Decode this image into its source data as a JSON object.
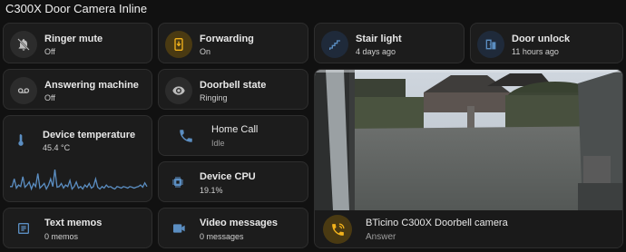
{
  "page": {
    "title": "C300X Door Camera Inline"
  },
  "tiles": {
    "ringer_mute": {
      "name": "Ringer mute",
      "state": "Off",
      "icon": "bell-off-icon"
    },
    "forwarding": {
      "name": "Forwarding",
      "state": "On",
      "icon": "forward-phone-icon"
    },
    "stair_light": {
      "name": "Stair light",
      "state": "4 days ago",
      "icon": "stairs-icon"
    },
    "door_unlock": {
      "name": "Door unlock",
      "state": "11 hours ago",
      "icon": "door-icon"
    },
    "answering_machine": {
      "name": "Answering machine",
      "state": "Off",
      "icon": "voicemail-icon"
    },
    "doorbell_state": {
      "name": "Doorbell state",
      "state": "Ringing",
      "icon": "eye-icon"
    },
    "device_temperature": {
      "name": "Device temperature",
      "state": "45.4 °C",
      "icon": "thermometer-icon"
    },
    "home_call": {
      "name": "Home Call",
      "state": "Idle",
      "icon": "phone-icon"
    },
    "device_cpu": {
      "name": "Device CPU",
      "state": "19.1%",
      "icon": "cpu-icon"
    },
    "text_memos": {
      "name": "Text memos",
      "state": "0 memos",
      "icon": "memo-icon"
    },
    "video_messages": {
      "name": "Video messages",
      "state": "0 messages",
      "icon": "video-icon"
    }
  },
  "camera": {
    "name": "BTicino C300X Doorbell camera",
    "state": "Answer",
    "icon": "phone-ring-icon"
  },
  "colors": {
    "accent": "#f2b21b",
    "icon": "#bdbdbd",
    "sparkline": "#5b8ec2",
    "tile_bg": "#1c1c1c"
  },
  "temperature_history": [
    0.3,
    0.3,
    0.55,
    0.25,
    0.35,
    0.3,
    0.62,
    0.28,
    0.35,
    0.45,
    0.22,
    0.4,
    0.3,
    0.72,
    0.25,
    0.32,
    0.4,
    0.22,
    0.35,
    0.55,
    0.3,
    0.85,
    0.28,
    0.3,
    0.4,
    0.25,
    0.35,
    0.3,
    0.5,
    0.22,
    0.3,
    0.45,
    0.25,
    0.3,
    0.22,
    0.35,
    0.28,
    0.4,
    0.25,
    0.3,
    0.55,
    0.28,
    0.22,
    0.3,
    0.25,
    0.35,
    0.28,
    0.3,
    0.25,
    0.22,
    0.3,
    0.28,
    0.25,
    0.3,
    0.28,
    0.25,
    0.3,
    0.28,
    0.25,
    0.28,
    0.3,
    0.35,
    0.28,
    0.42,
    0.3
  ]
}
